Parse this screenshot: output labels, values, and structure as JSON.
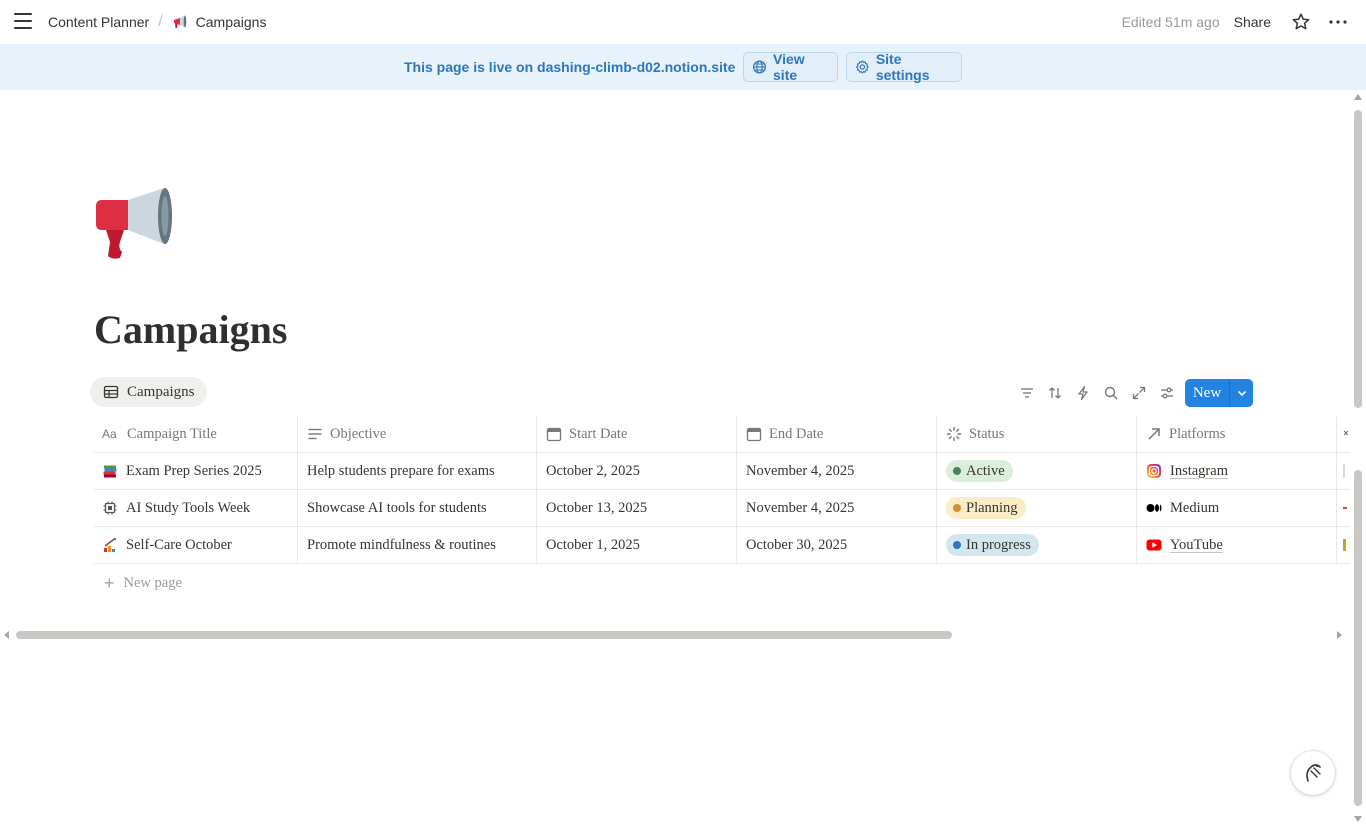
{
  "topbar": {
    "breadcrumbs": [
      {
        "label": "Content Planner",
        "icon": ""
      },
      {
        "label": "Campaigns",
        "icon": "megaphone-icon"
      }
    ],
    "edited": "Edited 51m ago",
    "share_label": "Share"
  },
  "banner": {
    "text": "This page is live on dashing-climb-d02.notion.site",
    "view_site_label": "View site",
    "site_settings_label": "Site settings",
    "background": "#e7f2fa",
    "text_color": "#2e77bd"
  },
  "page": {
    "icon": "megaphone-icon",
    "title": "Campaigns"
  },
  "view": {
    "tab_label": "Campaigns",
    "new_label": "New",
    "accent": "#2383e2",
    "tools": [
      "filter-icon",
      "sort-icon",
      "automation-icon",
      "search-icon",
      "expand-icon",
      "settings-icon"
    ]
  },
  "table": {
    "columns": [
      {
        "label": "Campaign Title",
        "icon": "title-icon"
      },
      {
        "label": "Objective",
        "icon": "text-icon"
      },
      {
        "label": "Start Date",
        "icon": "calendar-icon"
      },
      {
        "label": "End Date",
        "icon": "calendar-icon"
      },
      {
        "label": "Status",
        "icon": "status-icon"
      },
      {
        "label": "Platforms",
        "icon": "relation-icon"
      }
    ],
    "rows": [
      {
        "icon": "books-icon",
        "title": "Exam Prep Series 2025",
        "objective": "Help students prepare for exams",
        "start": "October 2, 2025",
        "end": "November 4, 2025",
        "status": {
          "label": "Active",
          "bg": "#dbeddb",
          "dot": "#448361"
        },
        "platform": {
          "label": "Instagram",
          "icon": "instagram-icon"
        }
      },
      {
        "icon": "chip-icon",
        "title": "AI Study Tools Week",
        "objective": "Showcase AI tools for students",
        "start": "October 13, 2025",
        "end": "November 4, 2025",
        "status": {
          "label": "Planning",
          "bg": "#fbecc8",
          "dot": "#cb912f"
        },
        "platform": {
          "label": "Medium",
          "icon": "medium-icon"
        }
      },
      {
        "icon": "self-care-icon",
        "title": "Self-Care October",
        "objective": "Promote mindfulness & routines",
        "start": "October 1, 2025",
        "end": "October 30, 2025",
        "status": {
          "label": "In progress",
          "bg": "#d3e5ef",
          "dot": "#2e77bd"
        },
        "platform": {
          "label": "YouTube",
          "icon": "youtube-icon"
        }
      }
    ],
    "new_page_label": "New page"
  }
}
